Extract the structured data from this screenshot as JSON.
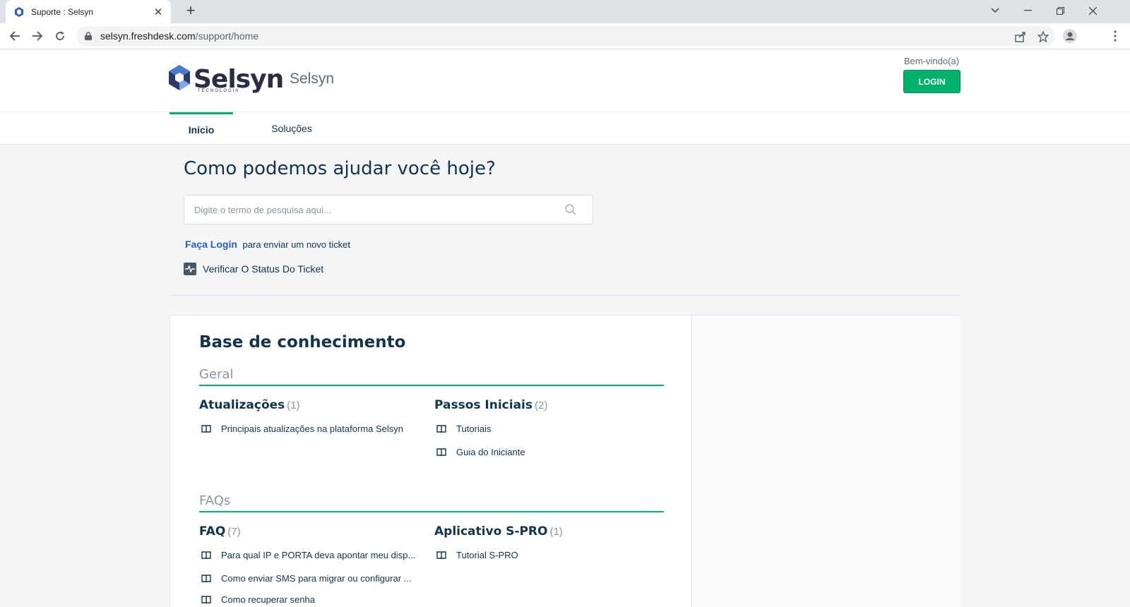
{
  "browser": {
    "tab_title": "Suporte : Selsyn",
    "url_host": "selsyn.freshdesk.com",
    "url_path": "/support/home",
    "new_tab": "+",
    "tab_close": "✕"
  },
  "header": {
    "logo_text": "Selsyn",
    "logo_sub": "TECNOLOGIA",
    "brand_name": "Selsyn",
    "welcome": "Bem-vindo(a)",
    "login_label": "LOGIN",
    "accent": "#00b26d"
  },
  "nav": {
    "items": [
      {
        "label": "Início",
        "active": true
      },
      {
        "label": "Soluções",
        "active": false
      }
    ]
  },
  "hero": {
    "title": "Como podemos ajudar você hoje?",
    "search_placeholder": "Digite o termo de pesquisa aqui...",
    "login_link": "Faça Login",
    "login_text": "para enviar um novo ticket",
    "status_link": "Verificar O Status Do Ticket"
  },
  "kb": {
    "title": "Base de conhecimento",
    "categories": [
      {
        "name": "Geral",
        "folders": [
          {
            "title": "Atualizações",
            "count": "(1)",
            "articles": [
              "Principais atualizações na plataforma Selsyn"
            ]
          },
          {
            "title": "Passos Iniciais",
            "count": "(2)",
            "articles": [
              "Tutoriais",
              "Guia do Iniciante"
            ]
          }
        ]
      },
      {
        "name": "FAQs",
        "folders": [
          {
            "title": "FAQ",
            "count": "(7)",
            "articles": [
              "Para qual IP e PORTA deva apontar meu disp...",
              "Como enviar SMS para migrar ou configurar ...",
              "Como recuperar senha"
            ]
          },
          {
            "title": "Aplicativo S-PRO",
            "count": "(1)",
            "articles": [
              "Tutorial S-PRO"
            ]
          }
        ]
      }
    ]
  }
}
